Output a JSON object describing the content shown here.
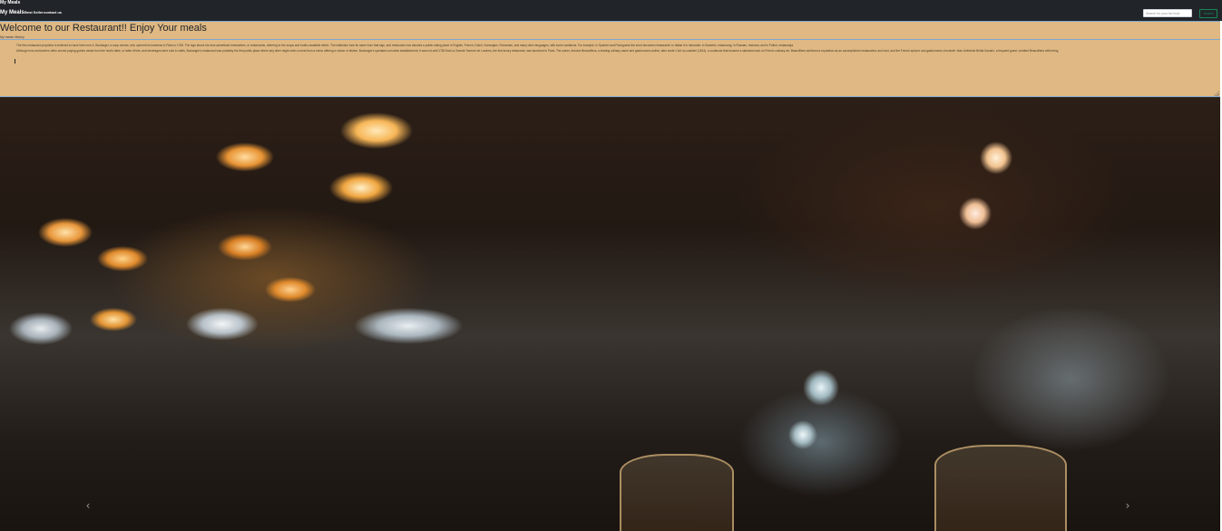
{
  "window": {
    "title": "My Meals"
  },
  "navbar": {
    "brand": "My Meals",
    "links": [
      {
        "label": "Best Seller"
      },
      {
        "label": "contact us"
      }
    ],
    "search": {
      "placeholder": "Search for your fav food",
      "button_label": "Search",
      "button_color": "#198754"
    },
    "background": "#212529"
  },
  "main": {
    "welcome_title": "Welcome to our Restaurant!! Enjoy Your meals",
    "section_label": "My meals History",
    "panel_color": "#dfb883",
    "history_paragraph_1": "The first restaurant proprietor is believed to have been one A. Boulanger, a soup vendor, who opened his business in Paris in 1765. The sign above his door advertised restoratives, or restaurants, referring to the soups and broths available within. The institution took its name from that sign, and restaurant now denotes a public eating place in English, French, Dutch, Norwegian, Romanian, and many other languages, with some variations. For example, in Spanish and Portuguese the word becomes restaurante; in Italian it is ristorante; in Swedish, restaurang; in Russian, restoran; and in Polish, restauracja.",
    "history_paragraph_2": "Although inns and taverns often served paying guests meals from the host's table, or table d'hôte, and beverages were sold in cafés, Boulanger's restaurant was probably the first public place where any diner might order a meal from a menu offering a choice of dishes. Boulanger's operated a modest establishment; it was not until 1782 that La Grande Taverne de Londres, the first luxury restaurant, was launched in Paris. The owner, Antoine Beauvilliers, a leading culinary name and gastronomic author, later wrote L'Art du cuisinier (1814), a cookbook that became a standard work on French culinary art. Beauvilliers achieved a reputation as an accomplished restaurateur and host, and the French epicure and gastronomic chronicler Jean Anthelme Brillat-Savarin, a frequent guest, credited Beauvilliers with being"
  },
  "carousel": {
    "prev_icon": "chevron-left-icon",
    "next_icon": "chevron-right-icon",
    "prev_glyph": "‹",
    "next_glyph": "›"
  }
}
